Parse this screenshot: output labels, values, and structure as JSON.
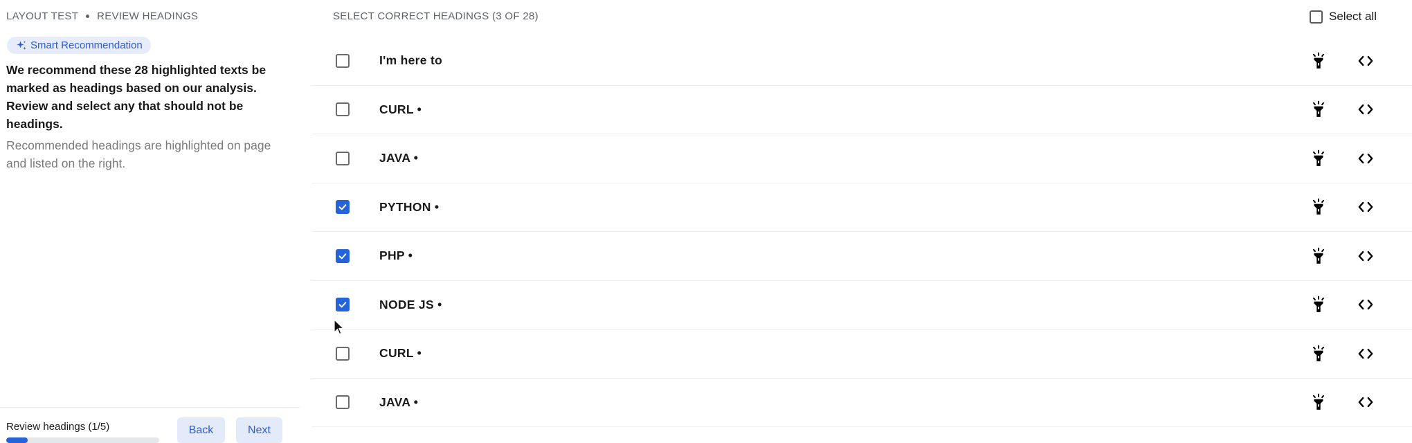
{
  "breadcrumb": {
    "items": [
      "LAYOUT TEST",
      "REVIEW HEADINGS"
    ]
  },
  "badge": {
    "label": "Smart Recommendation",
    "icon": "sparkle-icon"
  },
  "recommendation": {
    "title": "We recommend these 28 highlighted texts be marked as headings based on our analysis. Review and select any that should not be headings.",
    "subtitle": "Recommended headings are highlighted on page and listed on the right."
  },
  "footer": {
    "progress_label": "Review headings (1/5)",
    "progress_fraction": 0.14,
    "back_label": "Back",
    "next_label": "Next"
  },
  "list": {
    "header": "SELECT CORRECT HEADINGS (3 OF 28)",
    "select_all_label": "Select all",
    "select_all_checked": false,
    "rows": [
      {
        "label": "I'm here to",
        "checked": false
      },
      {
        "label": "CURL •",
        "checked": false
      },
      {
        "label": "JAVA •",
        "checked": false
      },
      {
        "label": "PYTHON •",
        "checked": true
      },
      {
        "label": "PHP •",
        "checked": true
      },
      {
        "label": "NODE JS •",
        "checked": true
      },
      {
        "label": "CURL •",
        "checked": false
      },
      {
        "label": "JAVA •",
        "checked": false
      }
    ],
    "row_icons": [
      "flashlight-icon",
      "code-icon"
    ]
  },
  "colors": {
    "accent": "#2563d9",
    "badge_bg": "#e6ecfb",
    "button_bg": "#e3ebfb",
    "muted_text": "#7a7a7a"
  }
}
